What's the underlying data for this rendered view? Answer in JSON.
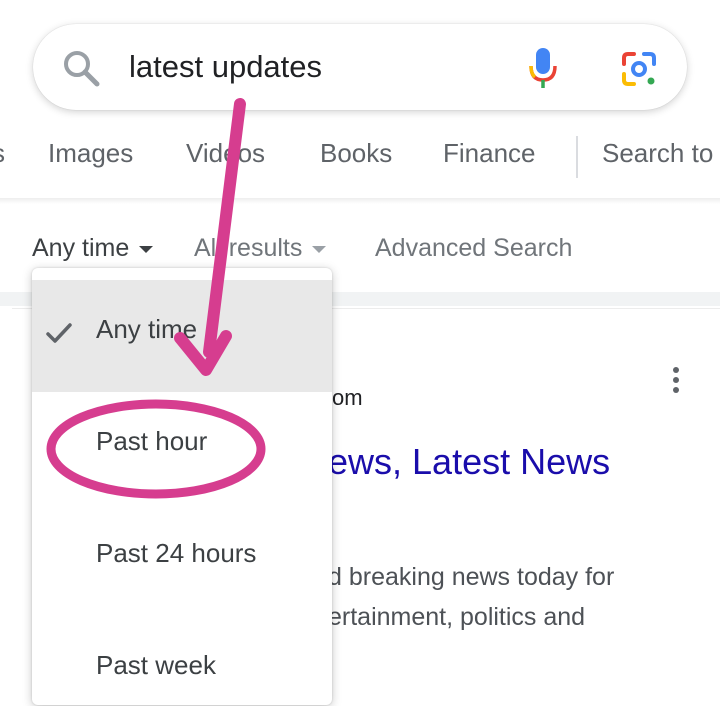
{
  "search": {
    "query": "latest updates"
  },
  "tabs": [
    {
      "label": "s"
    },
    {
      "label": "Images"
    },
    {
      "label": "Videos"
    },
    {
      "label": "Books"
    },
    {
      "label": "Finance"
    },
    {
      "label": "Search to"
    }
  ],
  "filters": {
    "time": "Any time",
    "results": "All results",
    "advanced": "Advanced Search"
  },
  "time_menu": {
    "items": [
      {
        "label": "Any time",
        "selected": true
      },
      {
        "label": "Past hour",
        "selected": false
      },
      {
        "label": "Past 24 hours",
        "selected": false
      },
      {
        "label": "Past week",
        "selected": false
      }
    ]
  },
  "result": {
    "domain_partial": "om",
    "title_partial": "ews, Latest News",
    "snippet_line1": "d breaking news today for",
    "snippet_line2": "ertainment, politics and"
  },
  "colors": {
    "annotation": "#d63d8f",
    "link": "#1a0dab",
    "menu_selected_bg": "#e8e8e8"
  },
  "icons": [
    "search-icon",
    "mic-icon",
    "lens-icon",
    "more-vert-icon",
    "check-icon",
    "caret-down-icon"
  ]
}
